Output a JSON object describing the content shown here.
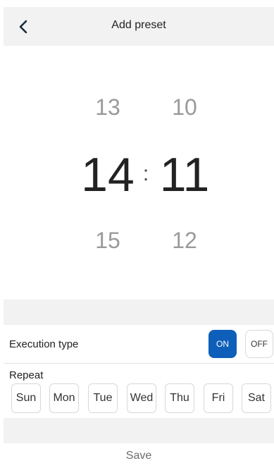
{
  "header": {
    "title": "Add preset",
    "back_icon": "chevron-left-icon"
  },
  "time_picker": {
    "hour": {
      "prev": "13",
      "selected": "14",
      "next": "15"
    },
    "minute": {
      "prev": "10",
      "selected": "11",
      "next": "12"
    },
    "separator": ":"
  },
  "execution": {
    "label": "Execution type",
    "on_label": "ON",
    "off_label": "OFF",
    "selected": "ON",
    "on_color": "#0d5fb9"
  },
  "repeat": {
    "label": "Repeat",
    "days": [
      "Sun",
      "Mon",
      "Tue",
      "Wed",
      "Thu",
      "Fri",
      "Sat"
    ]
  },
  "footer": {
    "save_label": "Save"
  }
}
